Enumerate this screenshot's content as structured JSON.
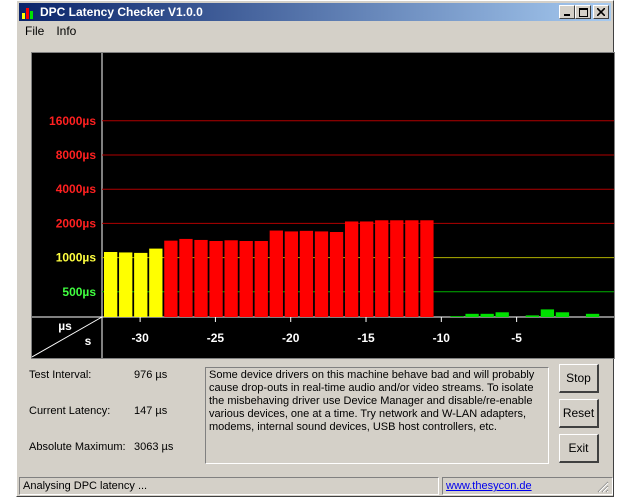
{
  "window": {
    "title": "DPC Latency Checker V1.0.0"
  },
  "menu": {
    "file": "File",
    "info": "Info"
  },
  "chart_data": {
    "type": "bar",
    "y_scale": "log",
    "y_ticks": [
      {
        "label": "16000µs",
        "value": 16000,
        "color": "#ff2020"
      },
      {
        "label": "8000µs",
        "value": 8000,
        "color": "#ff2020"
      },
      {
        "label": "4000µs",
        "value": 4000,
        "color": "#ff2020"
      },
      {
        "label": "2000µs",
        "value": 2000,
        "color": "#ff2020"
      },
      {
        "label": "1000µs",
        "value": 1000,
        "color": "#ffff40"
      },
      {
        "label": "500µs",
        "value": 500,
        "color": "#40ff40"
      }
    ],
    "x_ticks": [
      {
        "label": "-30",
        "value": -30
      },
      {
        "label": "-25",
        "value": -25
      },
      {
        "label": "-20",
        "value": -20
      },
      {
        "label": "-15",
        "value": -15
      },
      {
        "label": "-10",
        "value": -10
      },
      {
        "label": "-5",
        "value": -5
      }
    ],
    "y_unit_label": "µs",
    "x_unit_label": "s",
    "bars": [
      {
        "t": -32,
        "v": 1120,
        "color": "#ffff00"
      },
      {
        "t": -31,
        "v": 1110,
        "color": "#ffff00"
      },
      {
        "t": -30,
        "v": 1100,
        "color": "#ffff00"
      },
      {
        "t": -29,
        "v": 1200,
        "color": "#ffff00"
      },
      {
        "t": -28,
        "v": 1410,
        "color": "#ff0000"
      },
      {
        "t": -27,
        "v": 1460,
        "color": "#ff0000"
      },
      {
        "t": -26,
        "v": 1430,
        "color": "#ff0000"
      },
      {
        "t": -25,
        "v": 1400,
        "color": "#ff0000"
      },
      {
        "t": -24,
        "v": 1420,
        "color": "#ff0000"
      },
      {
        "t": -23,
        "v": 1400,
        "color": "#ff0000"
      },
      {
        "t": -22,
        "v": 1400,
        "color": "#ff0000"
      },
      {
        "t": -21,
        "v": 1730,
        "color": "#ff0000"
      },
      {
        "t": -20,
        "v": 1700,
        "color": "#ff0000"
      },
      {
        "t": -19,
        "v": 1720,
        "color": "#ff0000"
      },
      {
        "t": -18,
        "v": 1700,
        "color": "#ff0000"
      },
      {
        "t": -17,
        "v": 1680,
        "color": "#ff0000"
      },
      {
        "t": -16,
        "v": 2080,
        "color": "#ff0000"
      },
      {
        "t": -15,
        "v": 2080,
        "color": "#ff0000"
      },
      {
        "t": -14,
        "v": 2130,
        "color": "#ff0000"
      },
      {
        "t": -13,
        "v": 2130,
        "color": "#ff0000"
      },
      {
        "t": -12,
        "v": 2130,
        "color": "#ff0000"
      },
      {
        "t": -11,
        "v": 2130,
        "color": "#ff0000"
      },
      {
        "t": -10,
        "v": 300,
        "color": "#00e000"
      },
      {
        "t": -9,
        "v": 305,
        "color": "#00e000"
      },
      {
        "t": -8,
        "v": 320,
        "color": "#00e000"
      },
      {
        "t": -7,
        "v": 320,
        "color": "#00e000"
      },
      {
        "t": -6,
        "v": 330,
        "color": "#00e000"
      },
      {
        "t": -5,
        "v": 290,
        "color": "#00e000"
      },
      {
        "t": -4,
        "v": 310,
        "color": "#00e000"
      },
      {
        "t": -3,
        "v": 350,
        "color": "#00e000"
      },
      {
        "t": -2,
        "v": 330,
        "color": "#00e000"
      },
      {
        "t": -1,
        "v": 290,
        "color": "#00e000"
      },
      {
        "t": 0,
        "v": 320,
        "color": "#00e000"
      }
    ]
  },
  "info": {
    "test_interval_label": "Test Interval:",
    "test_interval_value": "976 µs",
    "current_latency_label": "Current Latency:",
    "current_latency_value": "147 µs",
    "absolute_max_label": "Absolute Maximum:",
    "absolute_max_value": "3063 µs"
  },
  "message": "Some device drivers on this machine behave bad and will probably cause drop-outs in real-time audio and/or video streams. To isolate the misbehaving driver use Device Manager and disable/re-enable various devices, one at a time. Try network and W-LAN adapters, modems, internal sound devices, USB host controllers, etc.",
  "buttons": {
    "stop": "Stop",
    "reset": "Reset",
    "exit": "Exit"
  },
  "status": {
    "text": "Analysing DPC latency ...",
    "link": "www.thesycon.de"
  }
}
